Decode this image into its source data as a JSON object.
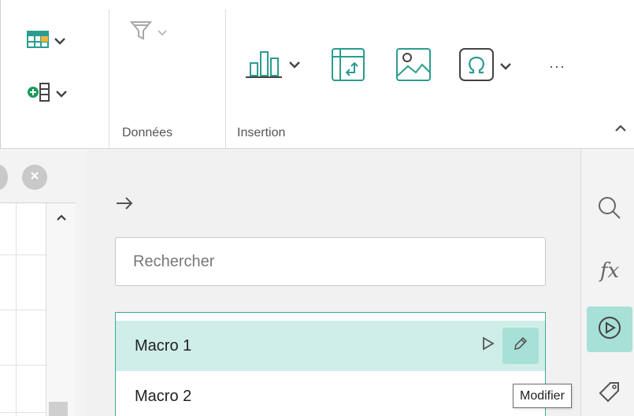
{
  "ribbon": {
    "groups": {
      "data_label": "Données",
      "insert_label": "Insertion"
    },
    "more_label": "···",
    "icons": {
      "table": "table-icon",
      "insert_column": "insert-column-icon",
      "filter": "filter-icon",
      "chart": "bar-chart-icon",
      "pivot": "pivot-table-icon",
      "picture": "picture-icon",
      "symbol": "omega-icon"
    }
  },
  "panel": {
    "search_placeholder": "Rechercher",
    "macros": [
      {
        "label": "Macro 1",
        "selected": true
      },
      {
        "label": "Macro 2",
        "selected": false
      }
    ],
    "tooltip": "Modifier"
  },
  "sidebar": {
    "fx_label": "fx",
    "active": "macros"
  },
  "colors": {
    "accent": "#3aa99b",
    "selected_row": "#cfeee9",
    "active_button": "#a7e0d6",
    "icon_teal": "#2a9d8f"
  }
}
